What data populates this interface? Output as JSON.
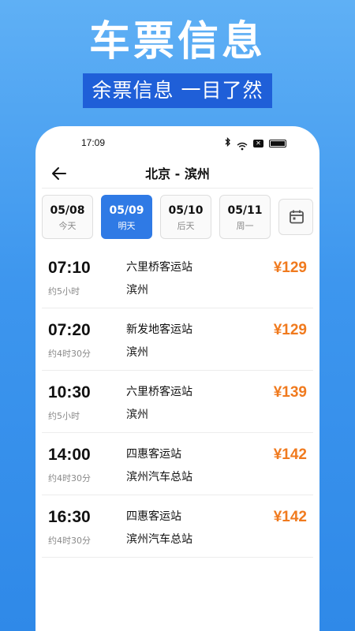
{
  "hero": {
    "title": "车票信息",
    "subtitle": "余票信息 一目了然"
  },
  "status_bar": {
    "time": "17:09",
    "icons": [
      "bluetooth-icon",
      "wifi-icon",
      "notification-x-icon",
      "battery-icon"
    ]
  },
  "nav": {
    "title": "北京 - 滨州",
    "back_icon": "arrow-left-icon"
  },
  "dates": [
    {
      "date": "05/08",
      "label": "今天",
      "active": false
    },
    {
      "date": "05/09",
      "label": "明天",
      "active": true
    },
    {
      "date": "05/10",
      "label": "后天",
      "active": false
    },
    {
      "date": "05/11",
      "label": "周一",
      "active": false
    }
  ],
  "calendar_icon": "calendar-icon",
  "trips": [
    {
      "time": "07:10",
      "duration": "约5小时",
      "from": "六里桥客运站",
      "to": "滨州",
      "price": "¥129"
    },
    {
      "time": "07:20",
      "duration": "约4时30分",
      "from": "新发地客运站",
      "to": "滨州",
      "price": "¥129"
    },
    {
      "time": "10:30",
      "duration": "约5小时",
      "from": "六里桥客运站",
      "to": "滨州",
      "price": "¥139"
    },
    {
      "time": "14:00",
      "duration": "约4时30分",
      "from": "四惠客运站",
      "to": "滨州汽车总站",
      "price": "¥142"
    },
    {
      "time": "16:30",
      "duration": "约4时30分",
      "from": "四惠客运站",
      "to": "滨州汽车总站",
      "price": "¥142"
    }
  ],
  "colors": {
    "accent": "#2f7ae5",
    "price": "#f07a1e",
    "banner": "#1f5fd8"
  }
}
